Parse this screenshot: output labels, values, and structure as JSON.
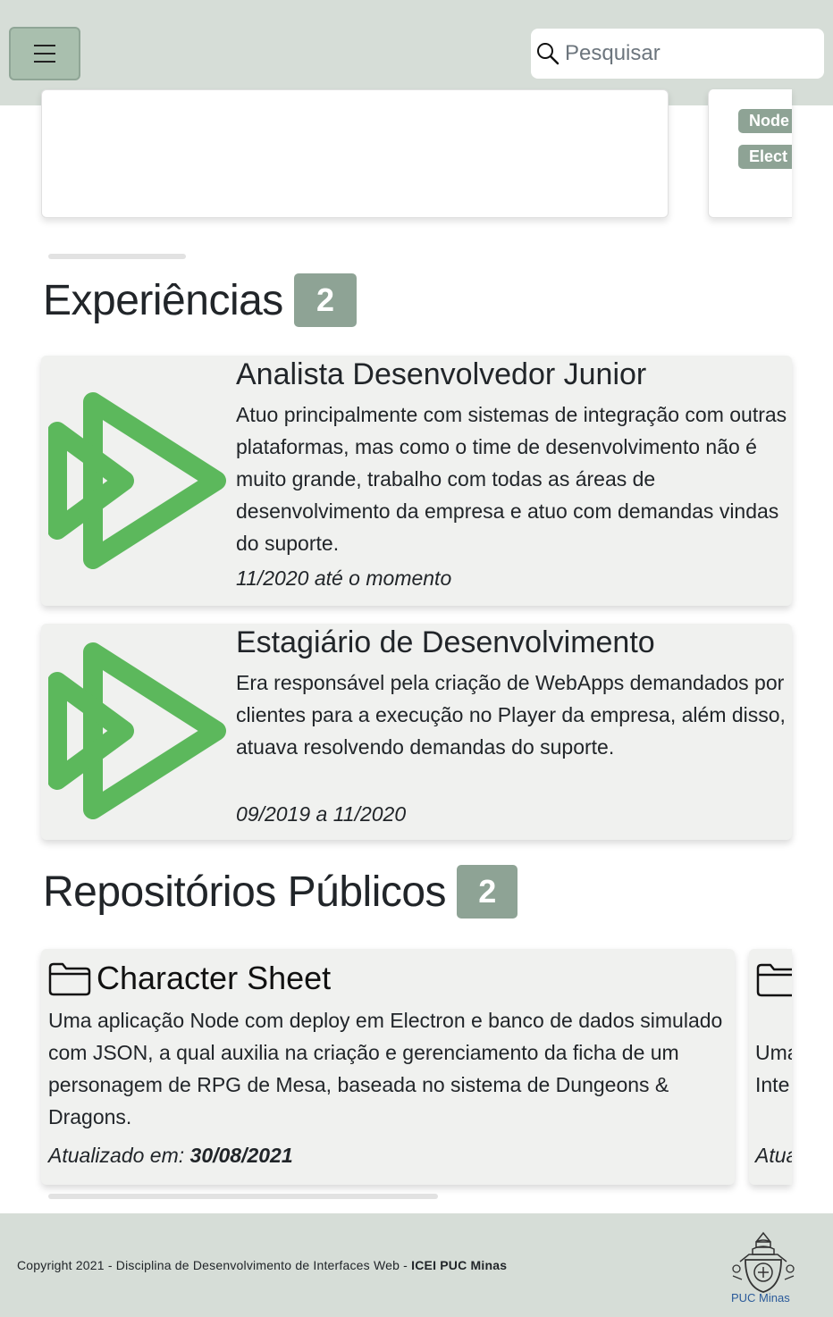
{
  "navbar": {
    "search_placeholder": "Pesquisar"
  },
  "top_cards": {
    "tags": [
      "Node",
      "Elect"
    ]
  },
  "experiences": {
    "title": "Experiências",
    "count": "2",
    "items": [
      {
        "title": "Analista Desenvolvedor Junior",
        "description": "Atuo principalmente com sistemas de integração com outras plataformas, mas como o time de desenvolvimento não é muito grande, trabalho com todas as áreas de desenvolvimento da empresa e atuo com demandas vindas do suporte.",
        "period": "11/2020 até o momento"
      },
      {
        "title": "Estagiário de Desenvolvimento",
        "description": "Era responsável pela criação de WebApps demandados por clientes para a execução no Player da empresa, além disso, atuava resolvendo demandas do suporte.",
        "period": "09/2019 a 11/2020"
      }
    ],
    "logo_color": "#5cb85c"
  },
  "repositories": {
    "title": "Repositórios Públicos",
    "count": "2",
    "items": [
      {
        "name": "Character Sheet",
        "description": "Uma aplicação Node com deploy em Electron e banco de dados simulado com JSON, a qual auxilia na criação e gerenciamento da ficha de um personagem de RPG de Mesa, baseada no sistema de Dungeons & Dragons.",
        "updated_label": "Atualizado em:",
        "updated_date": "30/08/2021"
      },
      {
        "desc_fragment_1": "Uma",
        "desc_fragment_2": "Inte",
        "updated_fragment": "Atua"
      }
    ]
  },
  "footer": {
    "copyright": "Copyright 2021 - Disciplina de Desenvolvimento de Interfaces Web - ",
    "org": "ICEI PUC Minas",
    "logo_label": "PUC Minas"
  },
  "colors": {
    "navbar_bg": "#d6ddd7",
    "badge_bg": "#8ea395",
    "card_bg": "#f0f1ef",
    "accent_green": "#5cb85c"
  }
}
